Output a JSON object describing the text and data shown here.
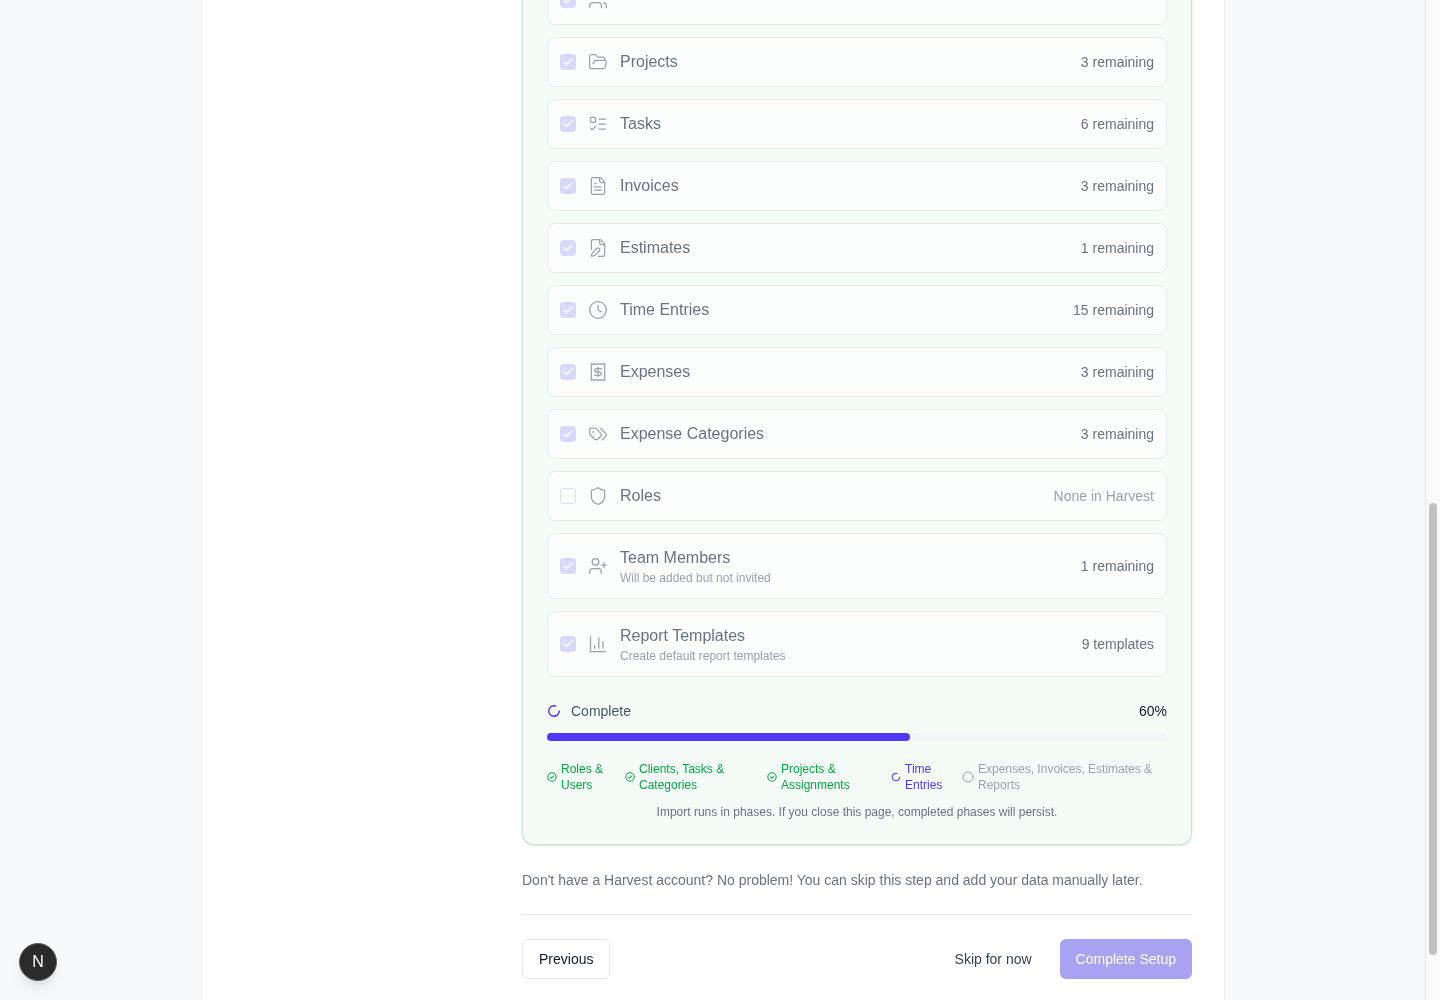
{
  "import_items": [
    {
      "checked": true
    },
    {
      "label": "Projects",
      "count": "3 remaining",
      "checked": true,
      "available": true
    },
    {
      "label": "Tasks",
      "count": "6 remaining",
      "checked": true,
      "available": true
    },
    {
      "label": "Invoices",
      "count": "3 remaining",
      "checked": true,
      "available": true
    },
    {
      "label": "Estimates",
      "count": "1 remaining",
      "checked": true,
      "available": true
    },
    {
      "label": "Time Entries",
      "count": "15 remaining",
      "checked": true,
      "available": true
    },
    {
      "label": "Expenses",
      "count": "3 remaining",
      "checked": true,
      "available": true
    },
    {
      "label": "Expense Categories",
      "count": "3 remaining",
      "checked": true,
      "available": true
    },
    {
      "label": "Roles",
      "count": "None in Harvest",
      "checked": false,
      "available": false
    },
    {
      "label": "Team Members",
      "note": "Will be added but not invited",
      "count": "1 remaining",
      "checked": true,
      "available": true
    },
    {
      "label": "Report Templates",
      "note": "Create default report templates",
      "count": "9 templates",
      "checked": true,
      "available": true
    }
  ],
  "progress": {
    "label": "Complete",
    "percent": "60%",
    "level": 0.585,
    "phases": [
      {
        "label": "Roles & Users",
        "kind": "done"
      },
      {
        "label": "Clients, Tasks & Categories",
        "kind": "done"
      },
      {
        "label": "Projects & Assignments",
        "kind": "done"
      },
      {
        "label": "Time Entries",
        "kind": "active"
      },
      {
        "label": "Expenses, Invoices, Estimates & Reports",
        "kind": "pending"
      }
    ],
    "note": "Import runs in phases. If you close this page, completed phases will persist."
  },
  "hint": "Don't have a Harvest account? No problem! You can skip this step and add your data manually later.",
  "footer": {
    "previous": {
      "label": "Previous"
    },
    "skip": {
      "label": "Skip for now"
    },
    "complete": {
      "label": "Complete Setup",
      "disabled": true
    }
  },
  "dev_badge": {
    "label": "N"
  }
}
